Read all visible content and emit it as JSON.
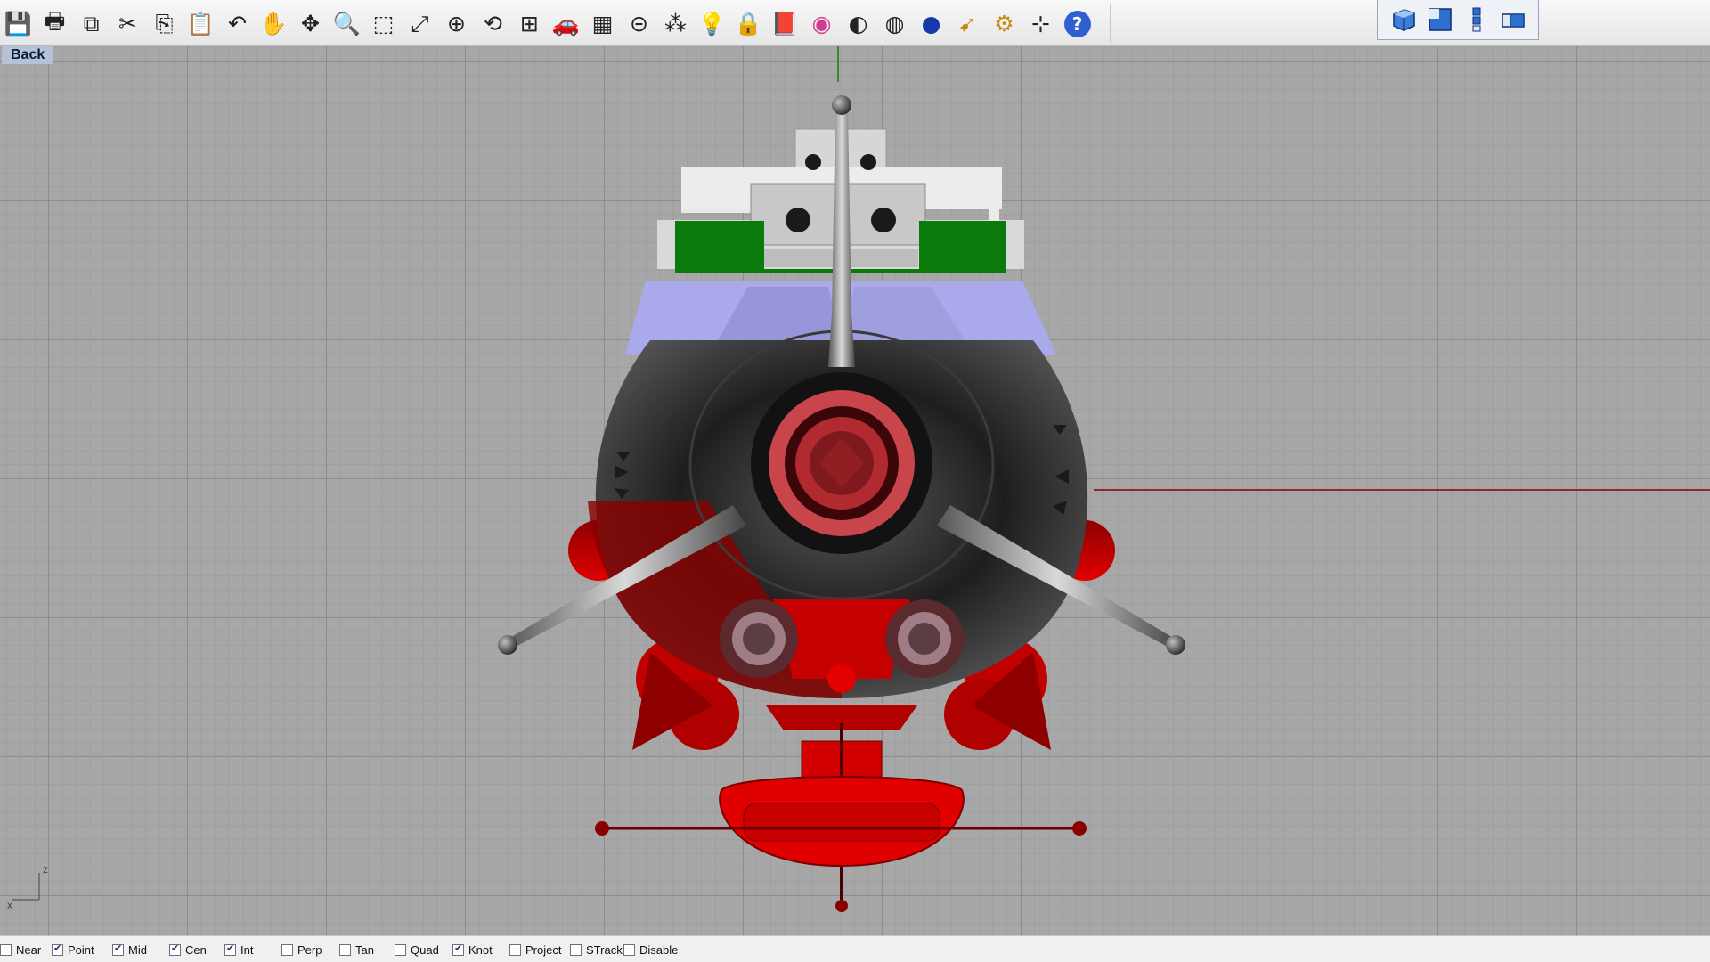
{
  "toolbar": {
    "tools": [
      {
        "name": "save-icon",
        "glyph": "💾"
      },
      {
        "name": "print-icon",
        "glyph": "🖶"
      },
      {
        "name": "export-icon",
        "glyph": "⧉"
      },
      {
        "name": "cut-icon",
        "glyph": "✂"
      },
      {
        "name": "copy-icon",
        "glyph": "⎘"
      },
      {
        "name": "paste-icon",
        "glyph": "📋"
      },
      {
        "name": "undo-icon",
        "glyph": "↶"
      },
      {
        "name": "pan-hand-icon",
        "glyph": "✋"
      },
      {
        "name": "rotate-view-icon",
        "glyph": "✥"
      },
      {
        "name": "zoom-icon",
        "glyph": "🔍"
      },
      {
        "name": "zoom-window-icon",
        "glyph": "⬚"
      },
      {
        "name": "zoom-extents-icon",
        "glyph": "⤢"
      },
      {
        "name": "zoom-selected-icon",
        "glyph": "⊕"
      },
      {
        "name": "undo-view-icon",
        "glyph": "⟲"
      },
      {
        "name": "four-viewports-icon",
        "glyph": "⊞"
      },
      {
        "name": "car-icon",
        "glyph": "🚗"
      },
      {
        "name": "grid-plane-icon",
        "glyph": "▦"
      },
      {
        "name": "osnap-icon",
        "glyph": "⊝"
      },
      {
        "name": "points-icon",
        "glyph": "⁂"
      },
      {
        "name": "light-icon",
        "glyph": "💡"
      },
      {
        "name": "lock-icon",
        "glyph": "🔒"
      },
      {
        "name": "layer-book-icon",
        "glyph": "📕"
      },
      {
        "name": "color-wheel-icon",
        "glyph": "◉"
      },
      {
        "name": "shaded-sphere-icon",
        "glyph": "◐"
      },
      {
        "name": "wireframe-sphere-icon",
        "glyph": "◍"
      },
      {
        "name": "render-sphere-icon",
        "glyph": "●"
      },
      {
        "name": "select-arrow-icon",
        "glyph": "➹"
      },
      {
        "name": "gear-icon",
        "glyph": "⚙"
      },
      {
        "name": "dimension-icon",
        "glyph": "⊹"
      },
      {
        "name": "help-icon",
        "glyph": "?"
      }
    ],
    "view_buttons": [
      "perspective-view-icon",
      "top-view-icon",
      "front-view-icon",
      "right-view-icon"
    ]
  },
  "viewport": {
    "title": "Back",
    "axis_labels": {
      "z": "z",
      "x": "x"
    }
  },
  "model_colors": {
    "hull": "#2b2b2b",
    "accent_red": "#d90000",
    "deck_green": "#0a7a0a",
    "lavender": "#a9a9ec",
    "tower_white": "#e4e4e4",
    "nozzle_ring": "#c8454b",
    "axis_x": "#8b2a2a",
    "axis_y": "#2f8f2f"
  },
  "statusbar": {
    "snaps": [
      {
        "label": "Near",
        "checked": false
      },
      {
        "label": "Point",
        "checked": true
      },
      {
        "label": "Mid",
        "checked": true
      },
      {
        "label": "Cen",
        "checked": true
      },
      {
        "label": "Int",
        "checked": true
      },
      {
        "label": "Perp",
        "checked": false
      },
      {
        "label": "Tan",
        "checked": false
      },
      {
        "label": "Quad",
        "checked": false
      },
      {
        "label": "Knot",
        "checked": true
      },
      {
        "label": "Project",
        "checked": false
      },
      {
        "label": "STrack",
        "checked": false
      },
      {
        "label": "Disable",
        "checked": false
      }
    ]
  }
}
